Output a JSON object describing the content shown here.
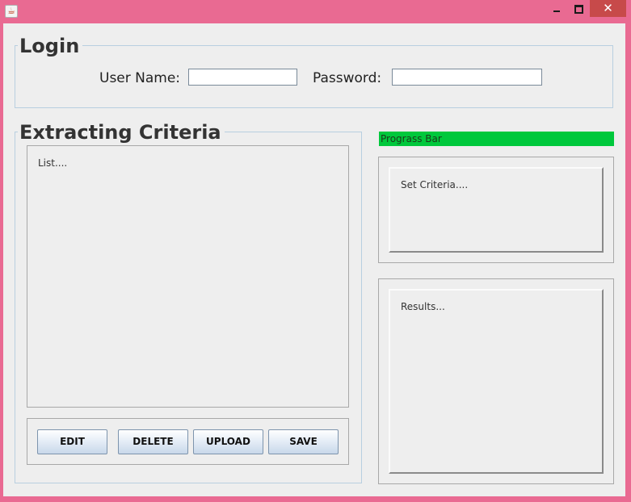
{
  "window": {
    "icon": "java-cup-icon",
    "controls": {
      "minimize": "minimize-icon",
      "maximize": "maximize-icon",
      "close": "✕"
    }
  },
  "login": {
    "title": "Login",
    "username_label": "User Name:",
    "username_value": "",
    "password_label": "Password:",
    "password_value": ""
  },
  "criteria": {
    "title": "Extracting Criteria",
    "list_text": "List....",
    "buttons": {
      "edit": "EDIT",
      "delete": "DELETE",
      "upload": "UPLOAD",
      "save": "SAVE"
    }
  },
  "progress": {
    "label": "Prograss Bar",
    "color": "#00c83c",
    "fraction": 1.0
  },
  "set_criteria_text": "Set Criteria....",
  "results_text": "Results...",
  "colors": {
    "frame": "#e96a92",
    "close": "#c74a4a",
    "panel": "#eeeeee",
    "group_border": "#b8cfe0"
  }
}
